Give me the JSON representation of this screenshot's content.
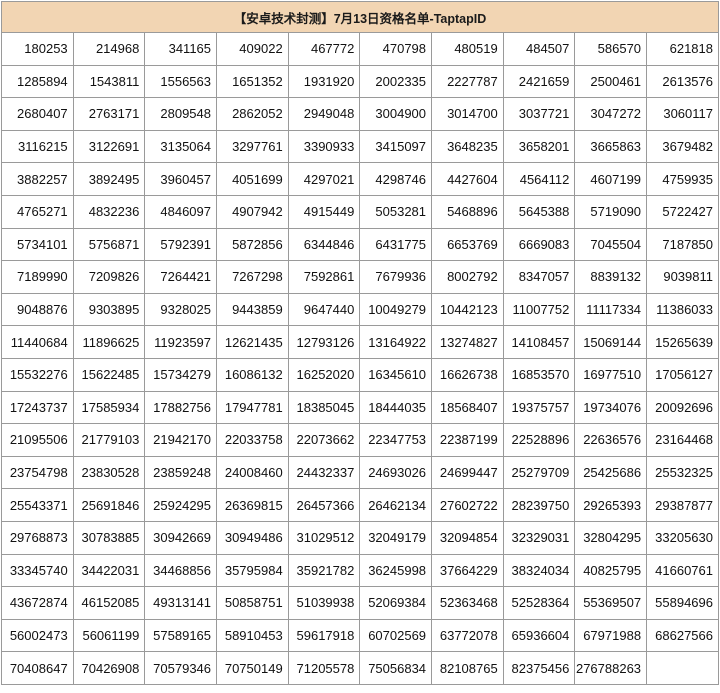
{
  "title": "【安卓技术封测】7月13日资格名单-TaptapID",
  "rows": [
    [
      "180253",
      "214968",
      "341165",
      "409022",
      "467772",
      "470798",
      "480519",
      "484507",
      "586570",
      "621818"
    ],
    [
      "1285894",
      "1543811",
      "1556563",
      "1651352",
      "1931920",
      "2002335",
      "2227787",
      "2421659",
      "2500461",
      "2613576"
    ],
    [
      "2680407",
      "2763171",
      "2809548",
      "2862052",
      "2949048",
      "3004900",
      "3014700",
      "3037721",
      "3047272",
      "3060117"
    ],
    [
      "3116215",
      "3122691",
      "3135064",
      "3297761",
      "3390933",
      "3415097",
      "3648235",
      "3658201",
      "3665863",
      "3679482"
    ],
    [
      "3882257",
      "3892495",
      "3960457",
      "4051699",
      "4297021",
      "4298746",
      "4427604",
      "4564112",
      "4607199",
      "4759935"
    ],
    [
      "4765271",
      "4832236",
      "4846097",
      "4907942",
      "4915449",
      "5053281",
      "5468896",
      "5645388",
      "5719090",
      "5722427"
    ],
    [
      "5734101",
      "5756871",
      "5792391",
      "5872856",
      "6344846",
      "6431775",
      "6653769",
      "6669083",
      "7045504",
      "7187850"
    ],
    [
      "7189990",
      "7209826",
      "7264421",
      "7267298",
      "7592861",
      "7679936",
      "8002792",
      "8347057",
      "8839132",
      "9039811"
    ],
    [
      "9048876",
      "9303895",
      "9328025",
      "9443859",
      "9647440",
      "10049279",
      "10442123",
      "11007752",
      "11117334",
      "11386033"
    ],
    [
      "11440684",
      "11896625",
      "11923597",
      "12621435",
      "12793126",
      "13164922",
      "13274827",
      "14108457",
      "15069144",
      "15265639"
    ],
    [
      "15532276",
      "15622485",
      "15734279",
      "16086132",
      "16252020",
      "16345610",
      "16626738",
      "16853570",
      "16977510",
      "17056127"
    ],
    [
      "17243737",
      "17585934",
      "17882756",
      "17947781",
      "18385045",
      "18444035",
      "18568407",
      "19375757",
      "19734076",
      "20092696"
    ],
    [
      "21095506",
      "21779103",
      "21942170",
      "22033758",
      "22073662",
      "22347753",
      "22387199",
      "22528896",
      "22636576",
      "23164468"
    ],
    [
      "23754798",
      "23830528",
      "23859248",
      "24008460",
      "24432337",
      "24693026",
      "24699447",
      "25279709",
      "25425686",
      "25532325"
    ],
    [
      "25543371",
      "25691846",
      "25924295",
      "26369815",
      "26457366",
      "26462134",
      "27602722",
      "28239750",
      "29265393",
      "29387877"
    ],
    [
      "29768873",
      "30783885",
      "30942669",
      "30949486",
      "31029512",
      "32049179",
      "32094854",
      "32329031",
      "32804295",
      "33205630"
    ],
    [
      "33345740",
      "34422031",
      "34468856",
      "35795984",
      "35921782",
      "36245998",
      "37664229",
      "38324034",
      "40825795",
      "41660761"
    ],
    [
      "43672874",
      "46152085",
      "49313141",
      "50858751",
      "51039938",
      "52069384",
      "52363468",
      "52528364",
      "55369507",
      "55894696"
    ],
    [
      "56002473",
      "56061199",
      "57589165",
      "58910453",
      "59617918",
      "60702569",
      "63772078",
      "65936604",
      "67971988",
      "68627566"
    ],
    [
      "70408647",
      "70426908",
      "70579346",
      "70750149",
      "71205578",
      "75056834",
      "82108765",
      "82375456",
      "276788263",
      ""
    ]
  ]
}
